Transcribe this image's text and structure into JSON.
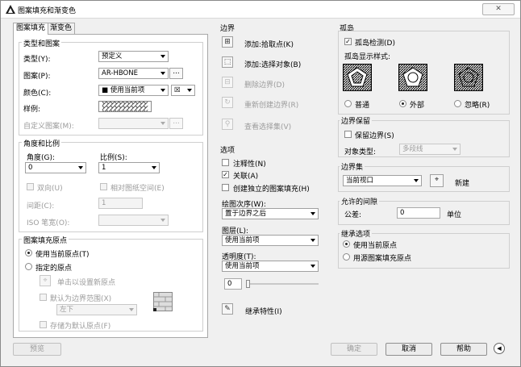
{
  "title": "图案填充和渐变色",
  "close_label": "✕",
  "tabs": [
    {
      "label": "图案填充"
    },
    {
      "label": "渐变色"
    }
  ],
  "type_pattern": {
    "group": "类型和图案",
    "type_label": "类型(Y):",
    "type_value": "预定义",
    "pattern_label": "图案(P):",
    "pattern_value": "AR-HBONE",
    "color_label": "颜色(C):",
    "color_value": "■ 使用当前项",
    "color_bg_value": "☒",
    "swatch_label": "样例:",
    "custom_label": "自定义图案(M):",
    "ellipsis": "..."
  },
  "angle_scale": {
    "group": "角度和比例",
    "angle_label": "角度(G):",
    "angle_value": "0",
    "scale_label": "比例(S):",
    "scale_value": "1",
    "double_label": "双向(U)",
    "relative_label": "相对图纸空间(E)",
    "spacing_label": "间距(C):",
    "spacing_value": "1",
    "iso_label": "ISO 笔宽(O):"
  },
  "origin": {
    "group": "图案填充原点",
    "use_current": "使用当前原点(T)",
    "specified": "指定的原点",
    "click_set": "单击以设置新原点",
    "default_extents": "默认为边界范围(X)",
    "position_value": "左下",
    "store_default": "存储为默认原点(F)"
  },
  "boundaries": {
    "group": "边界",
    "add_pick": "添加:拾取点(K)",
    "add_select": "添加:选择对象(B)",
    "remove": "删除边界(D)",
    "recreate": "重新创建边界(R)",
    "view": "查看选择集(V)"
  },
  "options": {
    "group": "选项",
    "annotative": "注释性(N)",
    "associative": "关联(A)",
    "separate": "创建独立的图案填充(H)",
    "draw_order_label": "绘图次序(W):",
    "draw_order_value": "置于边界之后",
    "layer_label": "图层(L):",
    "layer_value": "使用当前项",
    "transparency_label": "透明度(T):",
    "transparency_value": "使用当前项",
    "transparency_amount": "0"
  },
  "inherit": "继承特性(I)",
  "islands": {
    "group": "孤岛",
    "detect": "孤岛检测(D)",
    "style_label": "孤岛显示样式:",
    "normal": "普通",
    "outer": "外部",
    "ignore": "忽略(R)",
    "selected": "外部"
  },
  "boundary_retention": {
    "group": "边界保留",
    "retain": "保留边界(S)",
    "object_type_label": "对象类型:",
    "object_type_value": "多段线"
  },
  "boundary_set": {
    "group": "边界集",
    "value": "当前视口",
    "new_label": "新建"
  },
  "gap": {
    "group": "允许的间隙",
    "tolerance_label": "公差:",
    "tolerance_value": "0",
    "unit": "单位"
  },
  "inherit_options": {
    "group": "继承选项",
    "use_current": "使用当前原点",
    "use_source": "用源图案填充原点"
  },
  "footer": {
    "preview": "预览",
    "ok": "确定",
    "cancel": "取消",
    "help": "帮助",
    "more": "◀"
  }
}
